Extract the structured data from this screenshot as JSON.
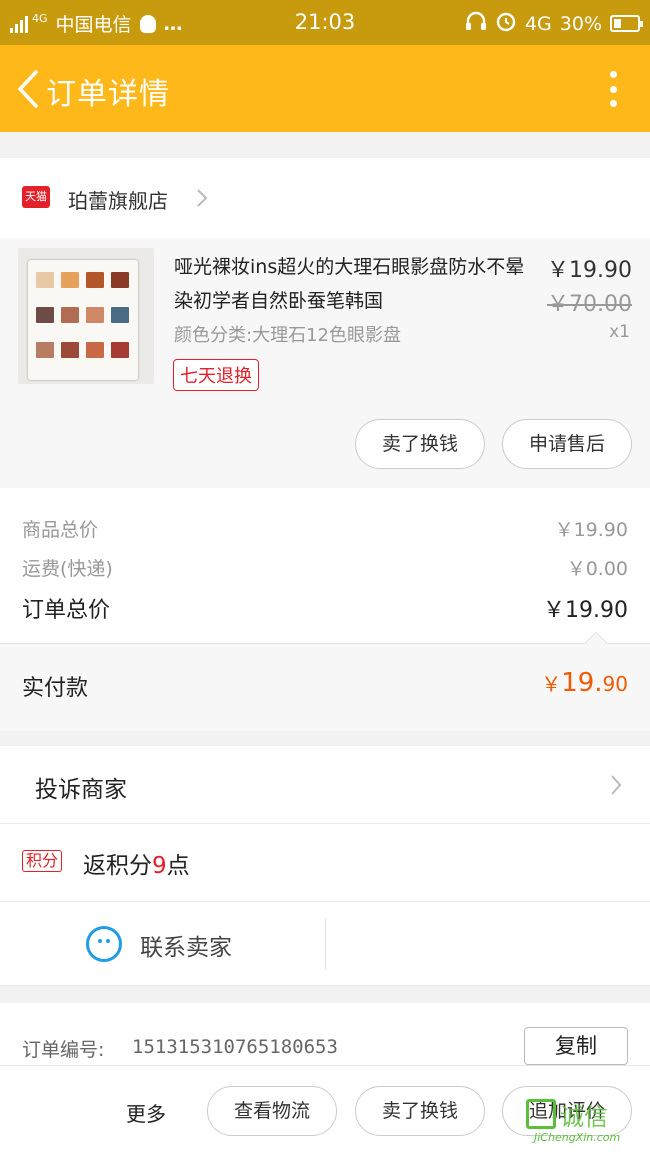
{
  "status_bar": {
    "network_badge": "4G",
    "carrier": "中国电信",
    "extra": "…",
    "time": "21:03",
    "network": "4G",
    "battery": "30%",
    "battery_level": 0.3
  },
  "nav": {
    "title": "订单详情"
  },
  "store": {
    "badge": "天猫",
    "name": "珀蕾旗舰店"
  },
  "product": {
    "title": "哑光裸妆ins超火的大理石眼影盘防水不晕染初学者自然卧蚕笔韩国",
    "spec": "颜色分类:大理石12色眼影盘",
    "return_tag": "七天退换",
    "price": "￥19.90",
    "original_price": "￥70.00",
    "quantity": "x1",
    "sell_button": "卖了换钱",
    "after_sale_button": "申请售后",
    "palette_colors": [
      "#e8c9a6",
      "#e6a15a",
      "#b4552c",
      "#8a3a26",
      "#6f4b45",
      "#b26c52",
      "#d08966",
      "#496b83",
      "#b67d62",
      "#9a4a36",
      "#c86a45",
      "#a53b32"
    ]
  },
  "summary": {
    "goods_total_label": "商品总价",
    "goods_total_value": "￥19.90",
    "shipping_label": "运费(快递)",
    "shipping_value": "￥0.00",
    "order_total_label": "订单总价",
    "order_total_value": "￥19.90"
  },
  "payment": {
    "label": "实付款",
    "currency": "￥",
    "amount_main": "19.",
    "amount_decimal": "90",
    "accent_color": "#f25a00"
  },
  "actions": {
    "complain_label": "投诉商家",
    "points_badge": "积分",
    "points_prefix": "返积分",
    "points_value": "9",
    "points_suffix": "点",
    "contact_label": "联系卖家"
  },
  "order_number": {
    "label": "订单编号:",
    "value": "151315310765180653",
    "copy_button": "复制"
  },
  "bottom_bar": {
    "more_label": "更多",
    "logistics_button": "查看物流",
    "sell_button": "卖了换钱",
    "review_button": "追加评价"
  },
  "watermark": {
    "text": "诚信",
    "domain": "JiChengXin.com"
  },
  "colors": {
    "status_bar": "#c89a0e",
    "nav_bar": "#ffb819",
    "tmall_red": "#e4202a",
    "contact_blue": "#1e9ce8"
  }
}
